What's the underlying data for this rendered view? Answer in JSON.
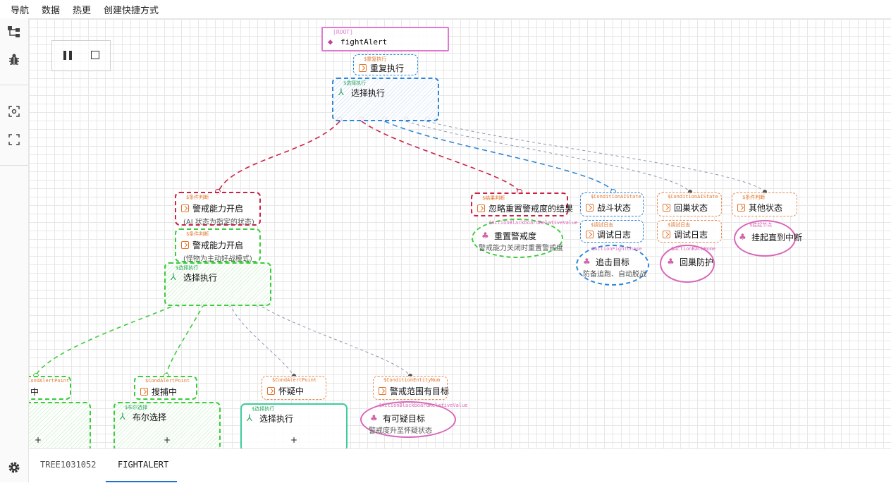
{
  "menu": {
    "items": [
      "导航",
      "数据",
      "热更",
      "创建快捷方式"
    ]
  },
  "sidebar": {
    "icons": [
      "tree-icon",
      "bug-icon",
      "focus-icon",
      "fullscreen-icon",
      "gear-icon"
    ]
  },
  "colors": {
    "red": "#cc2244",
    "green": "#3ccc3c",
    "blue": "#2d86d8",
    "orange": "#e88a50",
    "pink": "#d866b8",
    "root": "#e07ad0"
  },
  "tree": {
    "root": {
      "tag": "[ROOT]",
      "title": "fightAlert"
    },
    "repeat": {
      "tag": "$重复执行",
      "title": "重复执行"
    },
    "select_main": {
      "tag": "$选择执行",
      "title": "选择执行"
    },
    "alert_on1": {
      "tag": "$条件判断",
      "title": "警戒能力开启",
      "sub": "(AI 状态为指定的状态)"
    },
    "alert_on2": {
      "tag": "$条件判断",
      "title": "警戒能力开启",
      "sub": "(怪物为主动好战模式)"
    },
    "select_sub": {
      "tag": "$选择执行",
      "title": "选择执行"
    },
    "ignore_reset": {
      "tag": "$结果判断",
      "title": "忽略重置警戒度的结果"
    },
    "reset_alert": {
      "tag": "$ActionBlackboardRelativeValue",
      "title": "重置警戒度",
      "sub": "警戒能力关闭时重置警戒度"
    },
    "battle_state": {
      "tag": "$ConditionAIState",
      "title": "战斗状态"
    },
    "debug_log1": {
      "tag": "$调试日志",
      "title": "调试日志"
    },
    "chase": {
      "tag": "$ActionFightChase",
      "title": "追击目标",
      "sub": "防备追跑、自动脱战"
    },
    "return_state": {
      "tag": "$ConditionAIState",
      "title": "回巢状态"
    },
    "debug_log2": {
      "tag": "$调试日志",
      "title": "调试日志"
    },
    "return_defend": {
      "tag": "$ActionBackHome",
      "title": "回巢防护"
    },
    "other_state": {
      "tag": "$条件判断",
      "title": "其他状态"
    },
    "suspend": {
      "tag": "$挂起节点",
      "title": "挂起直到中断"
    },
    "partial": {
      "tag": "$CondAlertPoint",
      "title": "中"
    },
    "catching": {
      "tag": "$CondAlertPoint",
      "title": "搜捕中"
    },
    "bool_select": {
      "tag": "$布尔选择",
      "title": "布尔选择"
    },
    "suspicious": {
      "tag": "$CondAlertPoint",
      "title": "怀疑中"
    },
    "select_3": {
      "tag": "$选择执行",
      "title": "选择执行"
    },
    "range_target": {
      "tag": "$ConditionEntityNum",
      "title": "警戒范围有目标"
    },
    "suspicious_target": {
      "tag": "$ActionBlackboardRelativeValue",
      "title": "有可疑目标",
      "sub": "警戒度升至怀疑状态"
    }
  },
  "tabs": [
    "TREE1031052",
    "FIGHTALERT"
  ],
  "active_tab": "FIGHTALERT"
}
